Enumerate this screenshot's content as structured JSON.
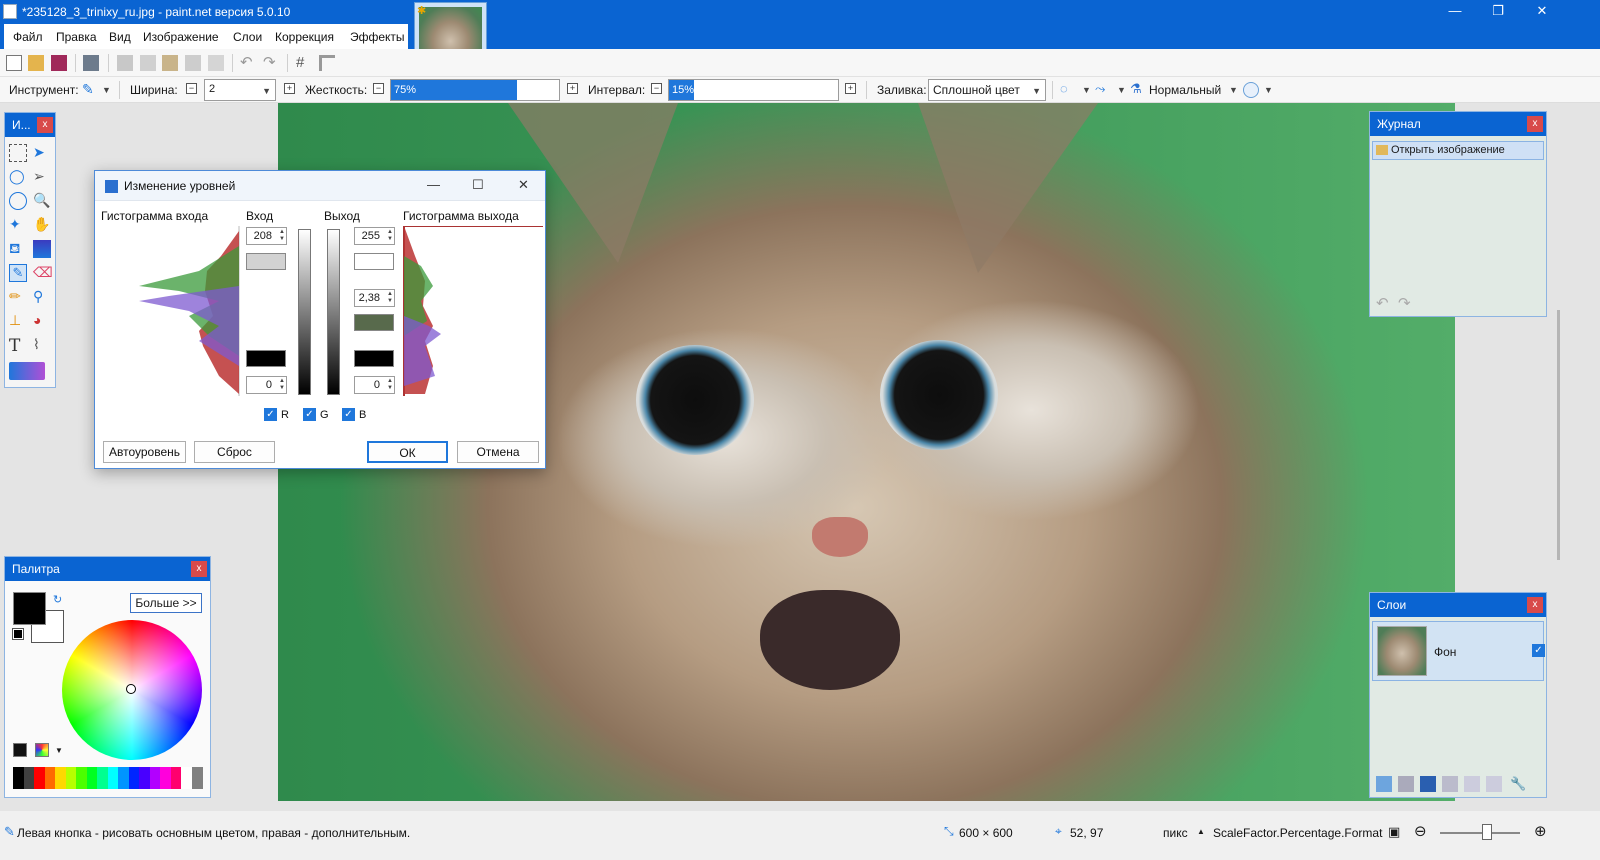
{
  "window": {
    "title": "*235128_3_trinixy_ru.jpg - paint.net версия 5.0.10",
    "controls": {
      "minimize": "—",
      "maximize": "❐",
      "close": "✕"
    }
  },
  "menu": {
    "items": [
      "Файл",
      "Правка",
      "Вид",
      "Изображение",
      "Слои",
      "Коррекция",
      "Эффекты"
    ]
  },
  "toolbar2": {
    "tool_label": "Инструмент:",
    "width_label": "Ширина:",
    "width_value": "2",
    "hardness_label": "Жесткость:",
    "hardness_value": "75%",
    "hardness_fraction": 0.75,
    "interval_label": "Интервал:",
    "interval_value": "15%",
    "interval_fraction": 0.15,
    "fill_label": "Заливка:",
    "fill_value": "Сплошной цвет",
    "blend_value": "Нормальный"
  },
  "tools_panel": {
    "title": "И..."
  },
  "palette": {
    "title": "Палитра",
    "more_label": "Больше >>",
    "primary_color": "#000000",
    "secondary_color": "#ffffff",
    "swatches": [
      "#000000",
      "#404040",
      "#ff0000",
      "#ff6a00",
      "#ffd800",
      "#b6ff00",
      "#4cff00",
      "#00ff21",
      "#00ff90",
      "#00ffff",
      "#0094ff",
      "#0026ff",
      "#4800ff",
      "#b200ff",
      "#ff00dc",
      "#ff006e",
      "#ffffff",
      "#808080"
    ]
  },
  "history": {
    "title": "Журнал",
    "items": [
      "Открыть изображение"
    ]
  },
  "layers": {
    "title": "Слои",
    "items": [
      {
        "name": "Фон",
        "visible": true
      }
    ]
  },
  "levels_dialog": {
    "title": "Изменение уровней",
    "input_histogram_label": "Гистограмма входа",
    "input_label": "Вход",
    "output_label": "Выход",
    "output_histogram_label": "Гистограмма выхода",
    "input_high": "208",
    "input_low": "0",
    "output_high": "255",
    "output_gamma": "2,38",
    "output_low": "0",
    "channels": [
      {
        "label": "R",
        "checked": true
      },
      {
        "label": "G",
        "checked": true
      },
      {
        "label": "B",
        "checked": true
      }
    ],
    "auto_button": "Автоуровень",
    "reset_button": "Сброс",
    "ok_button": "ОК",
    "cancel_button": "Отмена"
  },
  "status": {
    "hint": "Левая кнопка - рисовать основным цветом, правая - дополнительным.",
    "image_size": "600 × 600",
    "cursor_pos": "52, 97",
    "units": "пикс",
    "zoom_format": "ScaleFactor.Percentage.Format"
  }
}
